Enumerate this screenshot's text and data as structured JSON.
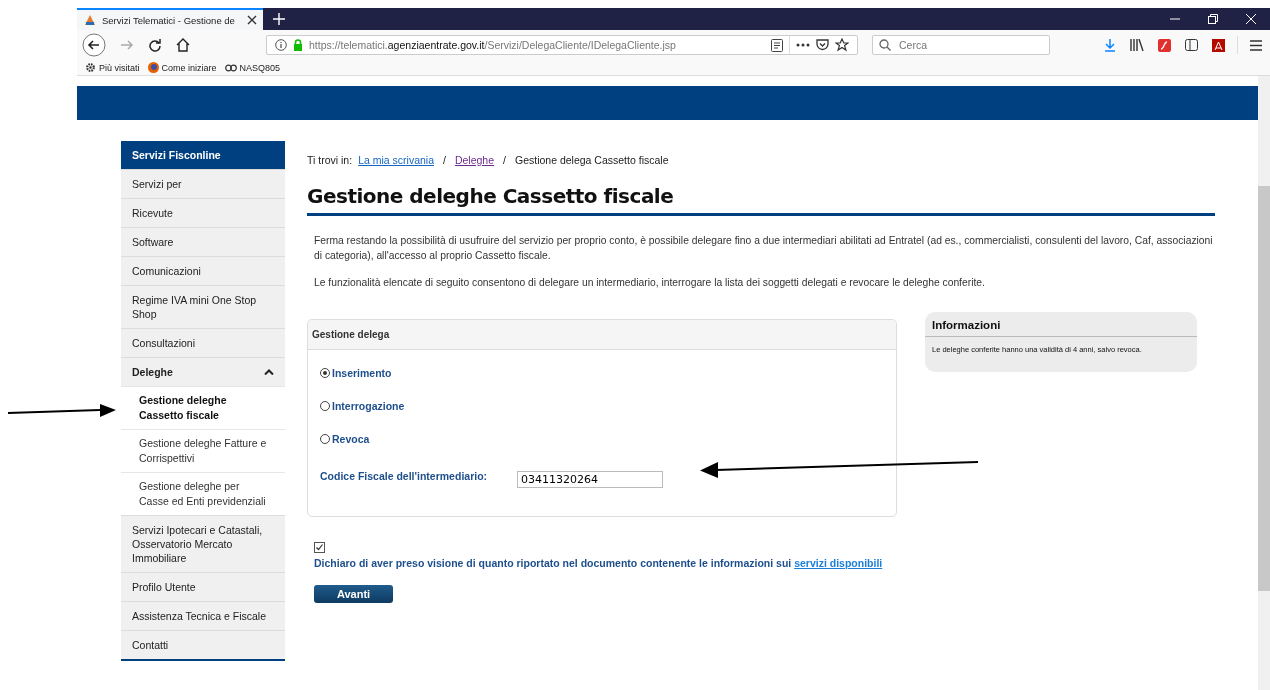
{
  "browser": {
    "tab_title": "Servizi Telematici - Gestione de",
    "url": {
      "prefix": "https://telematici.",
      "domain": "agenziaentrate.gov.it",
      "path": "/Servizi/DelegaCliente/IDelegaCliente.jsp"
    },
    "search": {
      "placeholder": "Cerca"
    },
    "bookmarks": [
      {
        "label": "Più visitati",
        "kind": "gear"
      },
      {
        "label": "Come iniziare",
        "kind": "globe"
      },
      {
        "label": "NASQ805",
        "kind": "link"
      }
    ]
  },
  "sidebar": {
    "header": "Servizi Fisconline",
    "items": [
      {
        "label": "Servizi per"
      },
      {
        "label": "Ricevute"
      },
      {
        "label": "Software"
      },
      {
        "label": "Comunicazioni"
      },
      {
        "label": "Regime IVA mini One Stop Shop"
      },
      {
        "label": "Consultazioni"
      },
      {
        "label": "Deleghe",
        "expanded": true,
        "children": [
          {
            "label": "Gestione deleghe Cassetto fiscale",
            "selected": true
          },
          {
            "label": "Gestione deleghe Fatture e Corrispettivi",
            "selected": false
          },
          {
            "label": "Gestione deleghe per Casse ed Enti previdenziali",
            "selected": false
          }
        ]
      },
      {
        "label": "Servizi Ipotecari e Catastali, Osservatorio Mercato Immobiliare"
      },
      {
        "label": "Profilo Utente"
      },
      {
        "label": "Assistenza Tecnica e Fiscale"
      },
      {
        "label": "Contatti"
      }
    ]
  },
  "breadcrumb": {
    "prefix": "Ti trovi in:",
    "separator": "/",
    "links": [
      {
        "label": "La mia scrivania",
        "visited": false
      },
      {
        "label": "Deleghe",
        "visited": true
      }
    ],
    "current": "Gestione delega Cassetto fiscale"
  },
  "title": "Gestione deleghe Cassetto fiscale",
  "paragraphs": [
    "Ferma restando la possibilità di usufruire del servizio per proprio conto, è possibile delegare fino a due intermediari abilitati ad Entratel (ad es., commercialisti, consulenti del lavoro, Caf, associazioni di categoria), all'accesso al proprio Cassetto fiscale.",
    "Le funzionalità elencate di seguito consentono di delegare un intermediario, interrogare la lista dei soggetti delegati e revocare le deleghe conferite."
  ],
  "form": {
    "title": "Gestione delega",
    "options": [
      {
        "label": "Inserimento",
        "selected": true
      },
      {
        "label": "Interrogazione",
        "selected": false
      },
      {
        "label": "Revoca",
        "selected": false
      }
    ],
    "field": {
      "label": "Codice Fiscale dell'intermediario:",
      "value": "03411320264"
    }
  },
  "info": {
    "title": "Informazioni",
    "text": "Le deleghe conferite hanno una validità di 4 anni, salvo revoca."
  },
  "declaration": {
    "checked": true,
    "text": "Dichiaro di aver preso visione di quanto riportato nel documento contenente le informazioni sui",
    "link": "servizi disponibili"
  },
  "button": "Avanti"
}
